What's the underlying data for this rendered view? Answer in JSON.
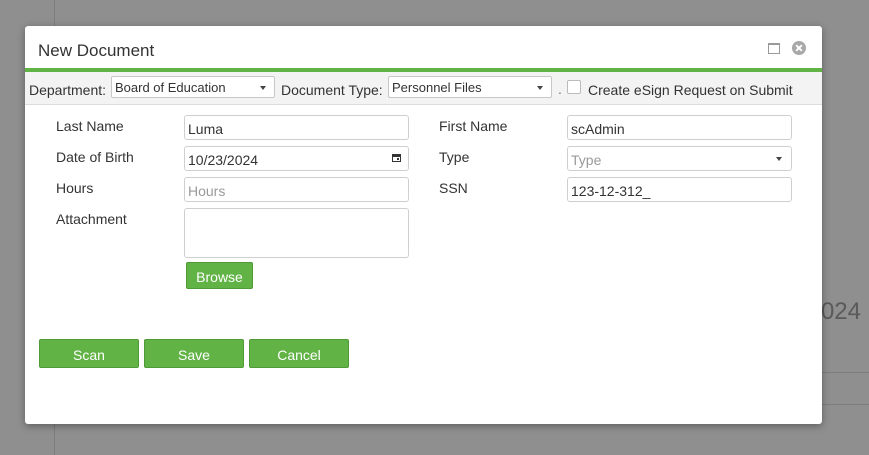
{
  "background": {
    "partial_text": "024"
  },
  "dialog": {
    "title": "New Document",
    "maximize_icon": "maximize-icon",
    "close_icon": "close-icon"
  },
  "toolbar": {
    "department_label": "Department:",
    "department_value": "Board of Education",
    "document_type_label": "Document Type:",
    "document_type_value": "Personnel Files",
    "separator": ".",
    "esign_label": "Create eSign Request on Submit",
    "esign_checked": false
  },
  "form": {
    "last_name": {
      "label": "Last Name",
      "value": "Luma"
    },
    "first_name": {
      "label": "First Name",
      "value": "scAdmin"
    },
    "date_of_birth": {
      "label": "Date of Birth",
      "value": "10/23/2024"
    },
    "type": {
      "label": "Type",
      "placeholder": "Type"
    },
    "hours": {
      "label": "Hours",
      "placeholder": "Hours"
    },
    "ssn": {
      "label": "SSN",
      "value": "123-12-312_"
    },
    "attachment": {
      "label": "Attachment",
      "browse_label": "Browse"
    }
  },
  "actions": {
    "scan": "Scan",
    "save": "Save",
    "cancel": "Cancel"
  },
  "colors": {
    "accent": "#62b346",
    "accent_border": "#4e9a36"
  }
}
